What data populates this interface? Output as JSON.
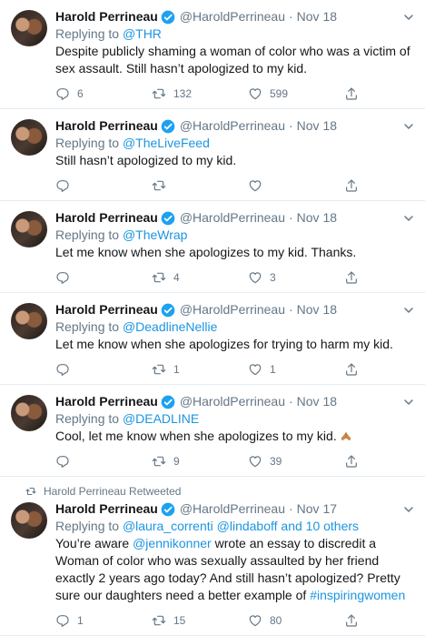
{
  "author": {
    "name": "Harold Perrineau",
    "handle": "@HaroldPerrineau"
  },
  "labels": {
    "replying_to": "Replying to",
    "retweeted": "Harold Perrineau Retweeted",
    "and_others": " and 10 others"
  },
  "colors": {
    "link": "#1b95e0",
    "muted": "#657786",
    "text": "#14171a",
    "verified": "#1da1f2"
  },
  "icons": [
    "avatar",
    "verified-badge-icon",
    "chevron-down-icon",
    "reply-icon",
    "retweet-icon",
    "like-icon",
    "share-icon",
    "folded-hands-emoji"
  ],
  "tweets": [
    {
      "date": "Nov 18",
      "reply_to": "@THR",
      "text": "Despite publicly shaming a woman of color who was a victim of sex assault. Still hasn’t apologized to my kid.",
      "replies": "6",
      "retweets": "132",
      "likes": "599"
    },
    {
      "date": "Nov 18",
      "reply_to": "@TheLiveFeed",
      "text": "Still hasn’t apologized to my kid.",
      "replies": "",
      "retweets": "",
      "likes": ""
    },
    {
      "date": "Nov 18",
      "reply_to": "@TheWrap",
      "text": "Let me know when she apologizes to my kid. Thanks.",
      "replies": "",
      "retweets": "4",
      "likes": "3"
    },
    {
      "date": "Nov 18",
      "reply_to": "@DeadlineNellie",
      "text": "Let me know when she apologizes for trying to harm my kid.",
      "replies": "",
      "retweets": "1",
      "likes": "1"
    },
    {
      "date": "Nov 18",
      "reply_to": "@DEADLINE",
      "text": "Cool, let me know when she apologizes to my kid.",
      "replies": "",
      "retweets": "9",
      "likes": "39"
    },
    {
      "date": "Nov 17",
      "reply_to": "@laura_correnti",
      "reply_to_2": "@lindaboff",
      "text_parts": [
        "You’re aware ",
        "@jennikonner",
        " wrote an essay to discredit a Woman of color who was sexually assaulted by her friend exactly 2 years ago today? And still hasn’t apologized? Pretty sure our daughters need a better example of ",
        "#inspiringwomen"
      ],
      "replies": "1",
      "retweets": "15",
      "likes": "80"
    }
  ]
}
